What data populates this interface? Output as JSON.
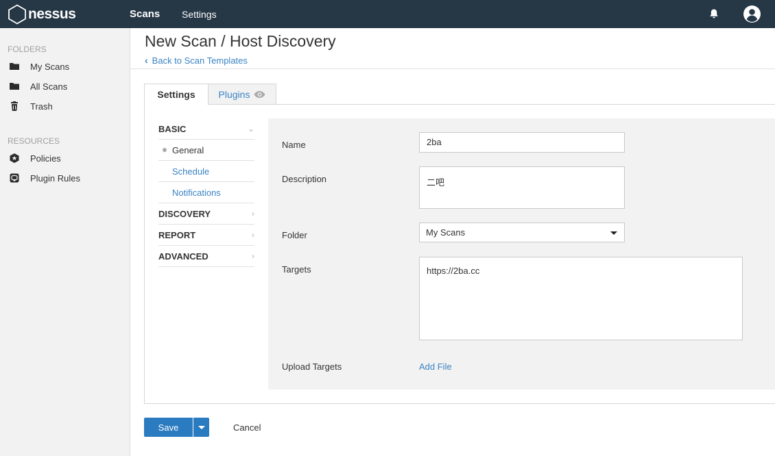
{
  "header": {
    "logo_text": "nessus",
    "nav": {
      "scans": "Scans",
      "settings": "Settings"
    },
    "icons": {
      "notifications": "bell-icon",
      "user": "user-avatar-icon"
    }
  },
  "sidebar": {
    "folders_heading": "FOLDERS",
    "folders": [
      {
        "label": "My Scans",
        "icon": "folder-icon"
      },
      {
        "label": "All Scans",
        "icon": "folder-icon"
      },
      {
        "label": "Trash",
        "icon": "trash-icon"
      }
    ],
    "resources_heading": "RESOURCES",
    "resources": [
      {
        "label": "Policies",
        "icon": "policy-shield-icon"
      },
      {
        "label": "Plugin Rules",
        "icon": "plugin-rules-icon"
      }
    ]
  },
  "page": {
    "title": "New Scan / Host Discovery",
    "back_link": "Back to Scan Templates"
  },
  "tabs": [
    {
      "label": "Settings",
      "active": true
    },
    {
      "label": "Plugins",
      "icon": "eye-icon"
    }
  ],
  "settings_menu": {
    "basic": "BASIC",
    "basic_items": [
      "General",
      "Schedule",
      "Notifications"
    ],
    "discovery": "DISCOVERY",
    "report": "REPORT",
    "advanced": "ADVANCED"
  },
  "form": {
    "name_label": "Name",
    "name_value": "2ba",
    "description_label": "Description",
    "description_value": "二吧",
    "folder_label": "Folder",
    "folder_value": "My Scans",
    "targets_label": "Targets",
    "targets_value": "https://2ba.cc",
    "upload_label": "Upload Targets",
    "add_file": "Add File"
  },
  "actions": {
    "save": "Save",
    "cancel": "Cancel"
  },
  "colors": {
    "topbar": "#263746",
    "accent": "#2a7bc0",
    "link": "#3a83c4"
  }
}
